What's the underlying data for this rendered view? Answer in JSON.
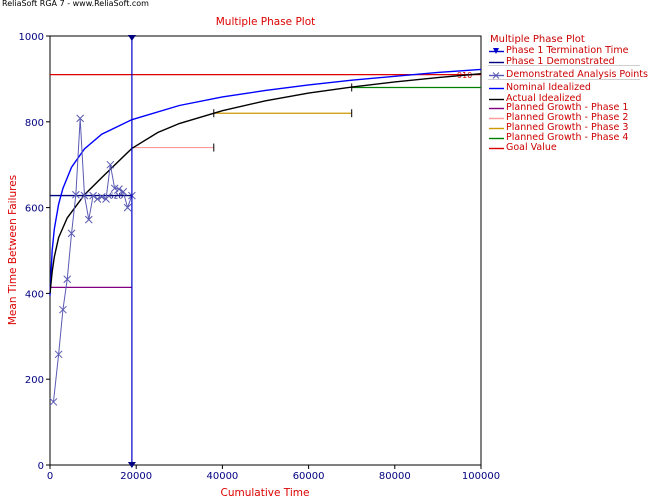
{
  "app": {
    "header": "ReliaSoft RGA 7 - www.ReliaSoft.com"
  },
  "chart_data": {
    "type": "line",
    "title": "Multiple Phase Plot",
    "xlabel": "Cumulative Time",
    "ylabel": "Mean Time Between Failures",
    "xlim": [
      0,
      100000
    ],
    "ylim": [
      0,
      1000
    ],
    "x_ticks": [
      0,
      20000,
      40000,
      60000,
      80000,
      100000
    ],
    "y_ticks": [
      0,
      200,
      400,
      600,
      800,
      1000
    ],
    "grid": false,
    "legend_position": "right",
    "legend_title": "Multiple Phase Plot",
    "legend": [
      {
        "label": "Phase 1 Termination Time",
        "color": "#0000cc",
        "marker": "triangle"
      },
      {
        "label": "Phase 1 Demonstrated",
        "color": "#000080",
        "marker": "line"
      },
      {
        "label": "Demonstrated Analysis Points",
        "color": "#5a5ab4",
        "marker": "x"
      },
      {
        "label": "Nominal Idealized",
        "color": "#0000ff",
        "marker": "line"
      },
      {
        "label": "Actual Idealized",
        "color": "#000000",
        "marker": "line"
      },
      {
        "label": "Planned Growth - Phase 1",
        "color": "#800080",
        "marker": "line"
      },
      {
        "label": "Planned Growth - Phase 2",
        "color": "#ff9999",
        "marker": "line"
      },
      {
        "label": "Planned Growth - Phase 3",
        "color": "#cc9900",
        "marker": "line"
      },
      {
        "label": "Planned Growth - Phase 4",
        "color": "#008000",
        "marker": "line"
      },
      {
        "label": "Goal Value",
        "color": "#dd0000",
        "marker": "line"
      }
    ],
    "phase1_termination_time": 19000,
    "phase1_demonstrated": {
      "value": 628,
      "label": "628"
    },
    "goal_value": {
      "value": 910,
      "label": "910"
    },
    "demonstrated_points": {
      "x": [
        800,
        2000,
        3000,
        4000,
        5000,
        6000,
        7000,
        8000,
        9000,
        10000,
        11000,
        12000,
        13000,
        14000,
        15000,
        16000,
        17000,
        18000,
        19000
      ],
      "y": [
        147,
        258,
        362,
        433,
        540,
        630,
        808,
        628,
        572,
        628,
        620,
        625,
        620,
        700,
        645,
        643,
        637,
        600,
        628
      ]
    },
    "nominal_idealized": {
      "x": [
        0,
        500,
        1000,
        2000,
        3000,
        5000,
        8000,
        12000,
        19000,
        30000,
        40000,
        50000,
        60000,
        70000,
        80000,
        90000,
        100000
      ],
      "y": [
        395,
        500,
        550,
        608,
        645,
        694,
        737,
        771,
        805,
        838,
        858,
        873,
        886,
        897,
        906,
        915,
        922
      ]
    },
    "actual_idealized": {
      "x": [
        0,
        500,
        1000,
        2000,
        4000,
        8000,
        12000,
        19000,
        25000,
        30000,
        40000,
        50000,
        60000,
        70000,
        80000,
        90000,
        100000
      ],
      "y": [
        400,
        450,
        485,
        530,
        576,
        630,
        670,
        738,
        775,
        796,
        826,
        849,
        867,
        881,
        893,
        903,
        912
      ]
    },
    "planned_growth": [
      {
        "phase": 1,
        "x": [
          0,
          19000
        ],
        "y": 414
      },
      {
        "phase": 2,
        "x": [
          19000,
          38000
        ],
        "y": 740
      },
      {
        "phase": 3,
        "x": [
          38000,
          70000
        ],
        "y": 820
      },
      {
        "phase": 4,
        "x": [
          70000,
          100000
        ],
        "y": 880
      }
    ]
  }
}
